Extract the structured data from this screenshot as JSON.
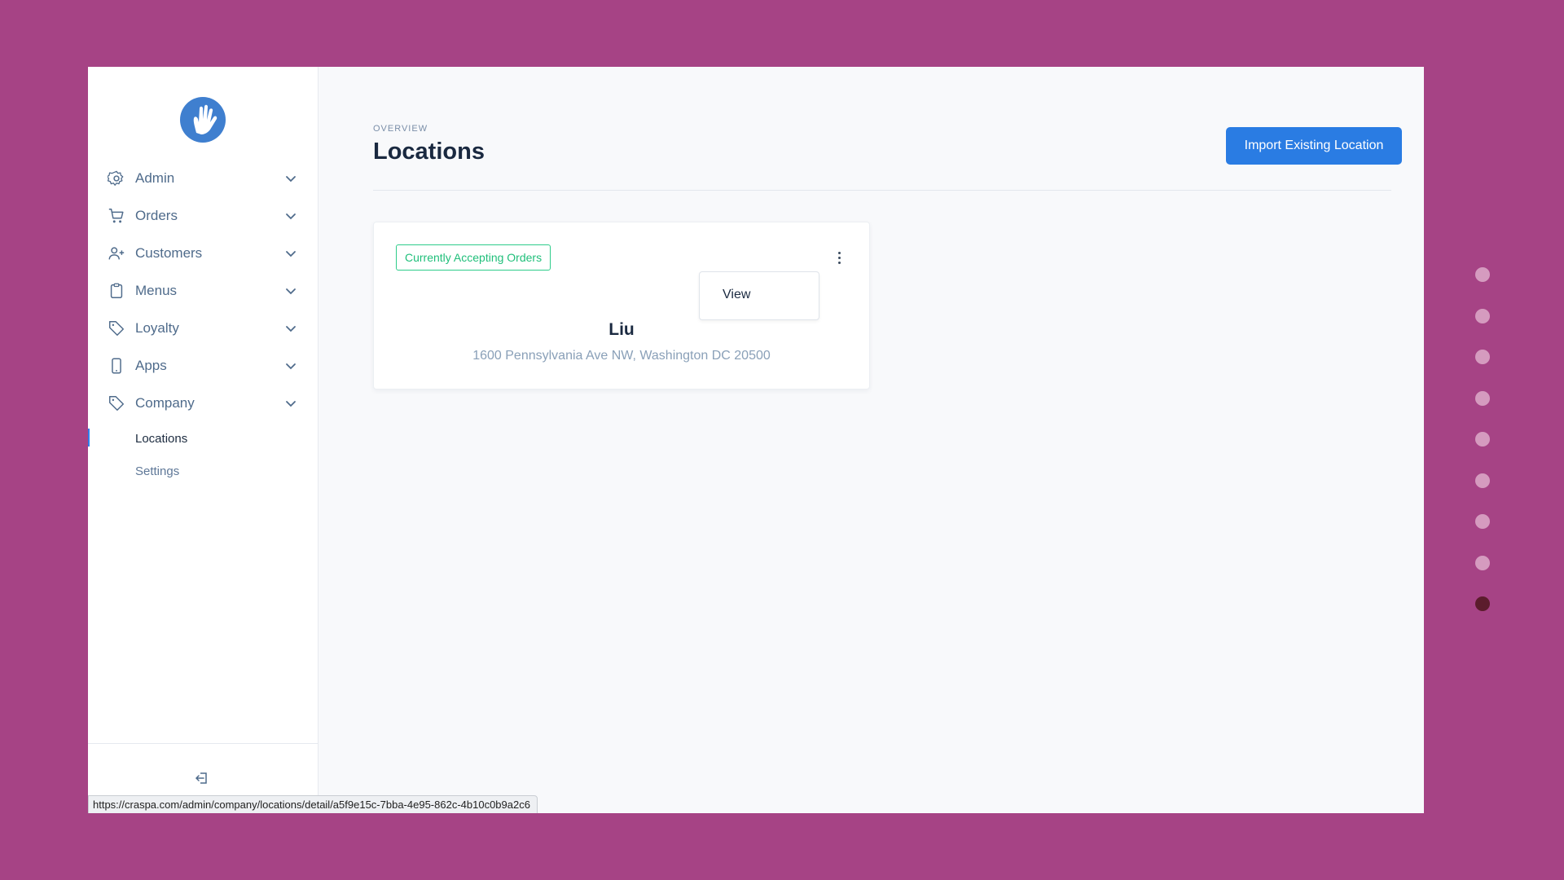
{
  "sidebar": {
    "items": [
      {
        "label": "Admin",
        "icon": "gear-icon"
      },
      {
        "label": "Orders",
        "icon": "cart-icon"
      },
      {
        "label": "Customers",
        "icon": "user-add-icon"
      },
      {
        "label": "Menus",
        "icon": "clipboard-icon"
      },
      {
        "label": "Loyalty",
        "icon": "tag-icon"
      },
      {
        "label": "Apps",
        "icon": "phone-icon"
      },
      {
        "label": "Company",
        "icon": "tag-icon"
      }
    ],
    "sub_items": [
      {
        "label": "Locations",
        "active": true
      },
      {
        "label": "Settings",
        "active": false
      }
    ]
  },
  "header": {
    "overline": "OVERVIEW",
    "title": "Locations",
    "import_button": "Import Existing Location"
  },
  "location_card": {
    "badge": "Currently Accepting Orders",
    "menu_option": "View",
    "name": "Liu",
    "address": "1600 Pennsylvania Ave NW, Washington DC 20500"
  },
  "status_bar": {
    "url": "https://craspa.com/admin/company/locations/detail/a5f9e15c-7bba-4e95-862c-4b10c0b9a2c6"
  },
  "slide_nav": {
    "total": 9,
    "active_index": 8
  },
  "colors": {
    "background": "#a64385",
    "accent": "#2a7ce3",
    "badge_green": "#1fbf7a",
    "active_dot": "#5b1c2c"
  }
}
